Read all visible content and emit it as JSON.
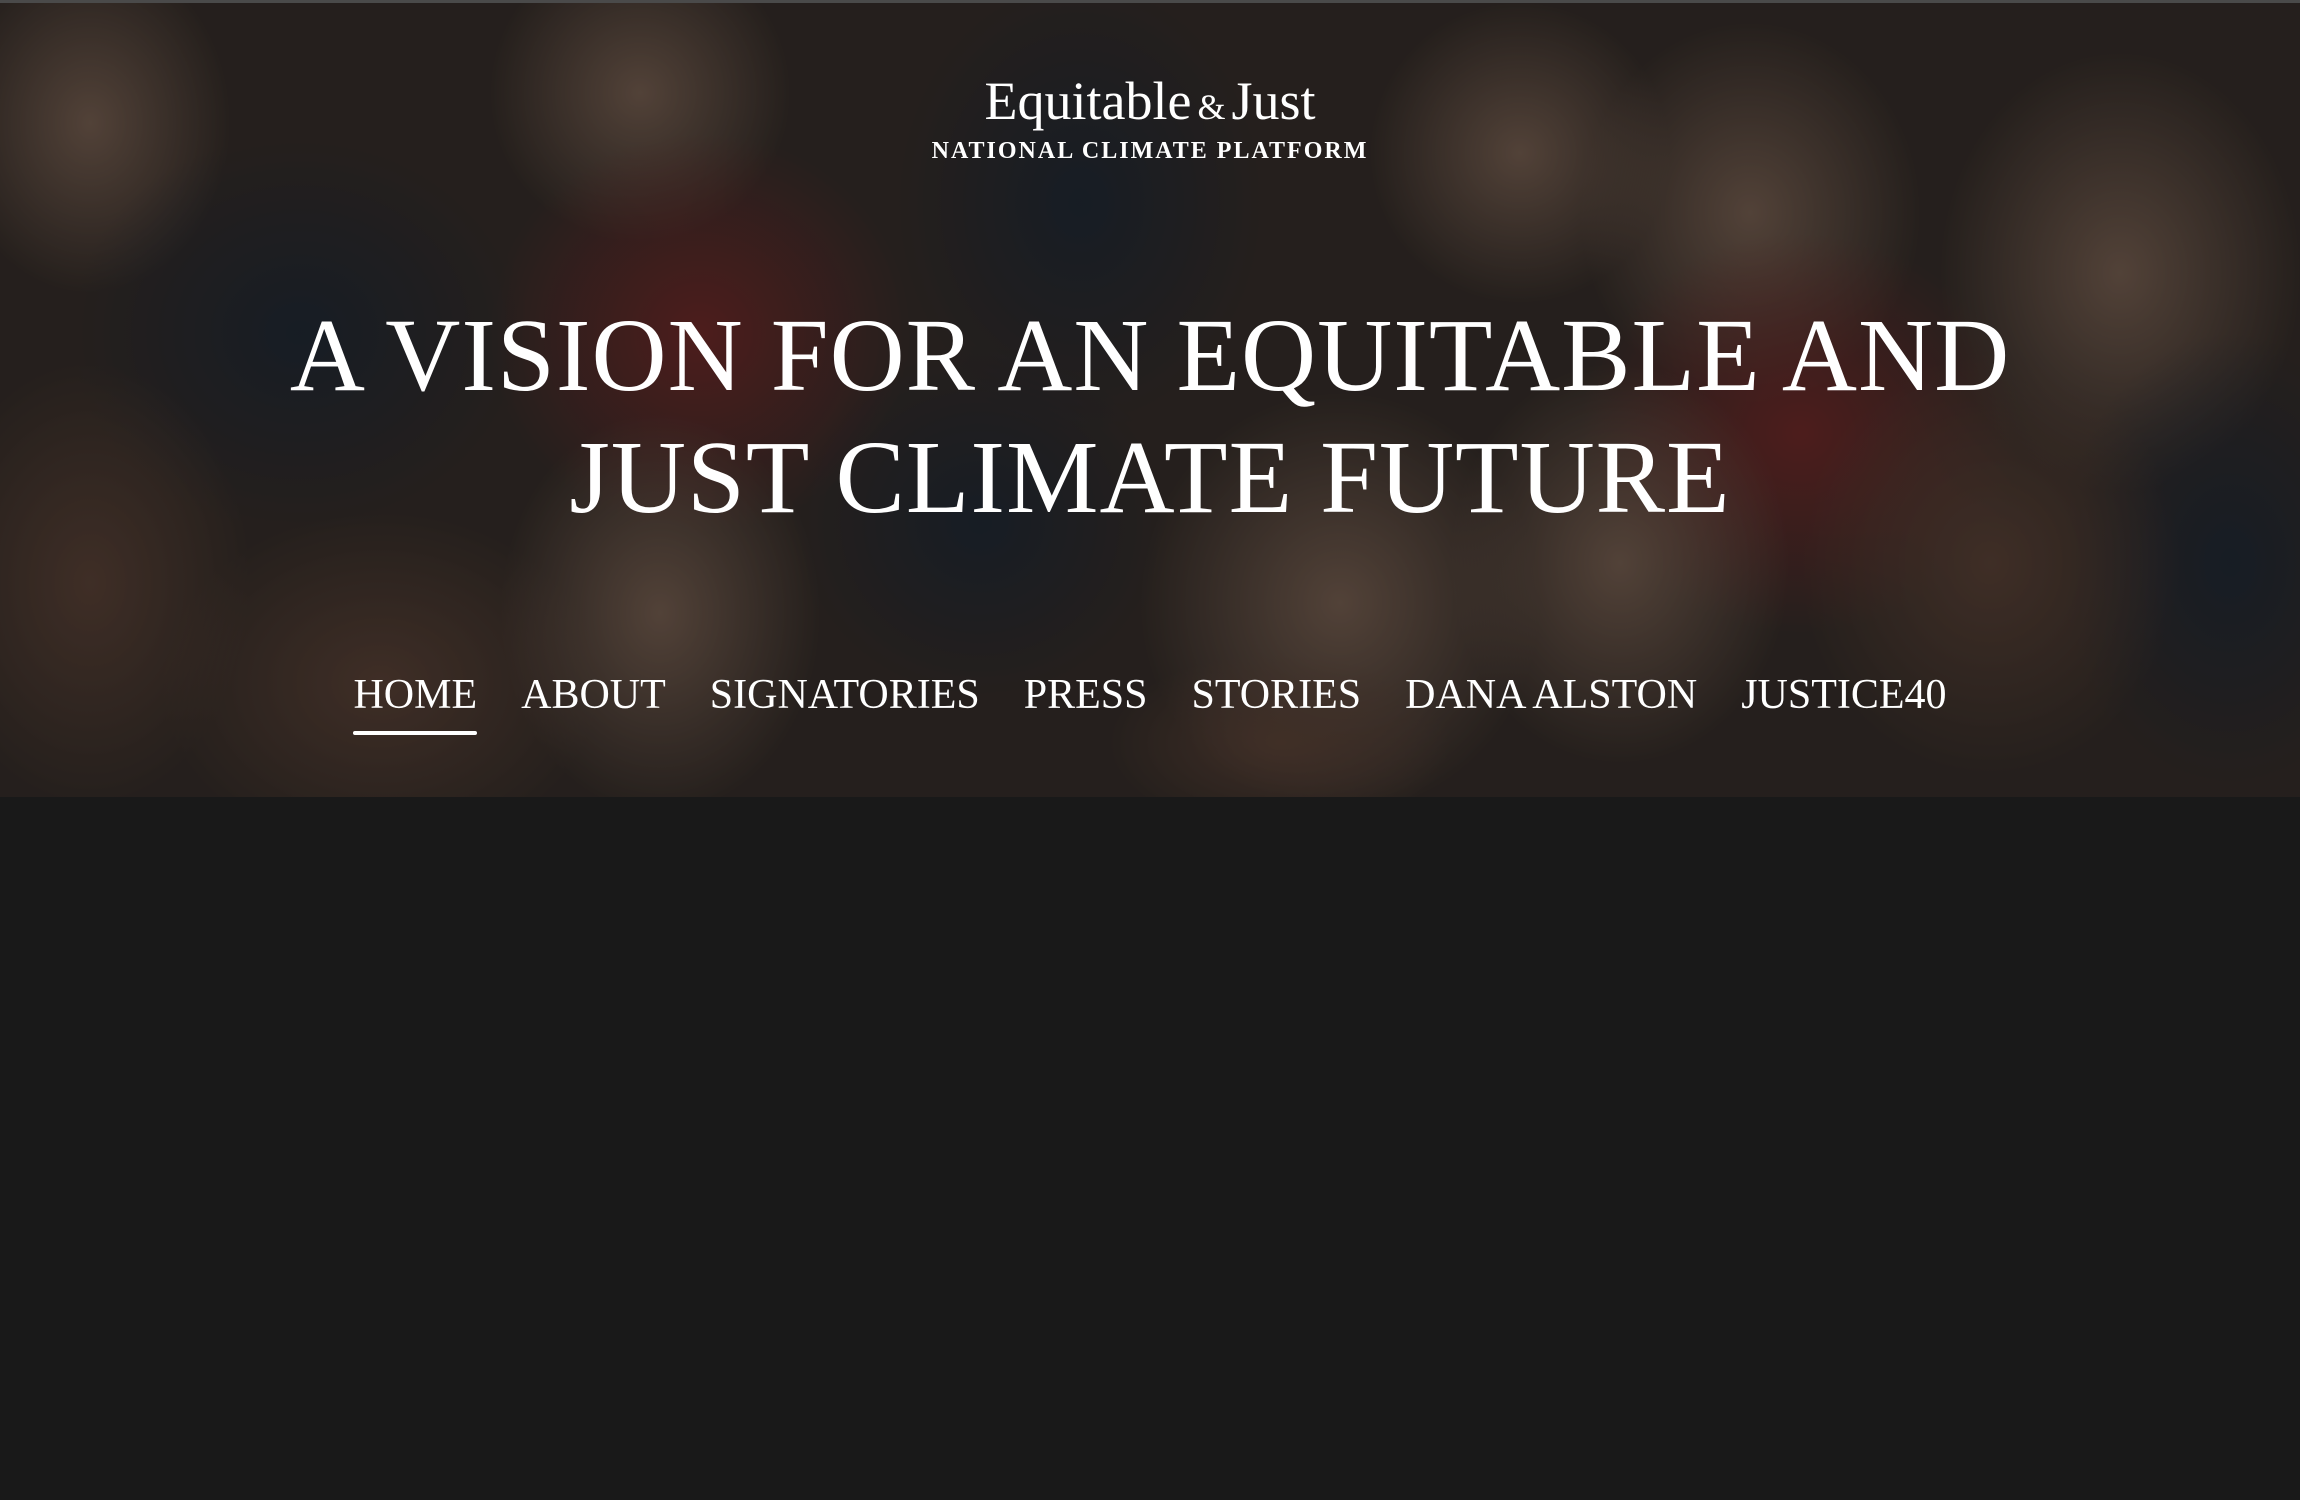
{
  "logo": {
    "main_part1": "Equitable",
    "amp": "&",
    "main_part2": "Just",
    "sub": "NATIONAL CLIMATE PLATFORM"
  },
  "hero": {
    "headline_line1": "A VISION FOR AN EQUITABLE AND",
    "headline_line2": "JUST CLIMATE FUTURE"
  },
  "nav": {
    "items": [
      {
        "label": "HOME",
        "active": true
      },
      {
        "label": "ABOUT"
      },
      {
        "label": "SIGNATORIES"
      },
      {
        "label": "PRESS"
      },
      {
        "label": "STORIES"
      },
      {
        "label": "DANA ALSTON"
      },
      {
        "label": "JUSTICE40"
      }
    ]
  },
  "colors": {
    "page_background": "#191919",
    "text": "#ffffff"
  }
}
